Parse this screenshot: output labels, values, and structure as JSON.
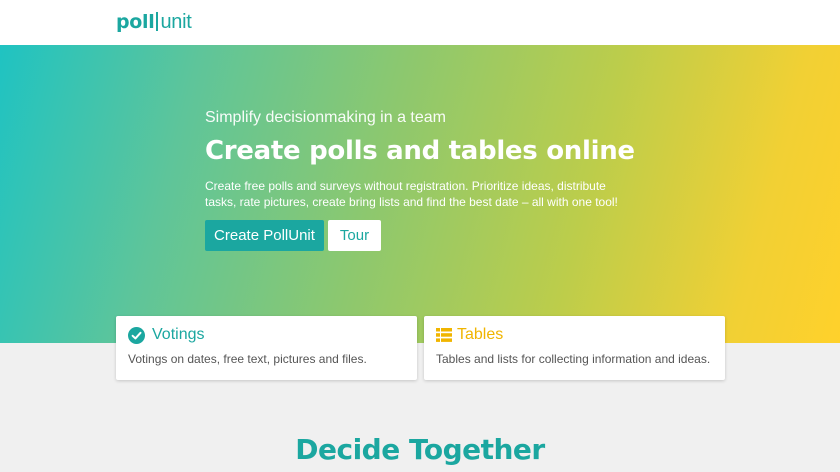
{
  "header": {
    "logo": {
      "part1": "poll",
      "part2": "unit"
    }
  },
  "hero": {
    "tagline": "Simplify decisionmaking in a team",
    "headline": "Create polls and tables online",
    "description": "Create free polls and surveys without registration. Prioritize ideas, distribute tasks, rate pictures, create bring lists and find the best date – all with one tool!",
    "primary_button": "Create PollUnit",
    "secondary_button": "Tour"
  },
  "cards": [
    {
      "title": "Votings",
      "text": "Votings on dates, free text, pictures and files.",
      "icon": "check-circle-icon",
      "color": "#1ba7a0"
    },
    {
      "title": "Tables",
      "text": "Tables and lists for collecting information and ideas.",
      "icon": "table-list-icon",
      "color": "#f0b500"
    }
  ],
  "section": {
    "title": "Decide Together"
  },
  "colors": {
    "brand": "#1ba7a0",
    "accent_yellow": "#f0b500"
  }
}
